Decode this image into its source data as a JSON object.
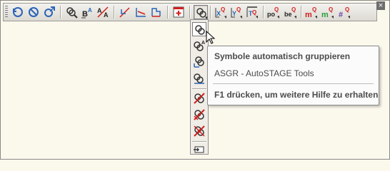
{
  "toolbar": {
    "close_glyph": "×",
    "buttons": [
      {
        "name": "rotate-icon",
        "label": ""
      },
      {
        "name": "rotate-cancel-icon",
        "label": ""
      },
      {
        "name": "rotate-arrow-icon",
        "label": ""
      },
      {
        "name": "position-number-search-icon",
        "label": ""
      },
      {
        "name": "text-size-b-a-icon",
        "label": "B A"
      },
      {
        "name": "text-size-a-a-icon",
        "label": "A A"
      },
      {
        "name": "dimension-line-icon",
        "label": ""
      },
      {
        "name": "arc-dimension-icon",
        "label": ""
      },
      {
        "name": "angle-dimension-icon",
        "label": ""
      },
      {
        "name": "insert-table-icon",
        "label": ""
      },
      {
        "name": "group-symbols-icon",
        "label": ""
      },
      {
        "name": "label-x-q-icon",
        "label": "X Q"
      },
      {
        "name": "label-y-q-icon",
        "label": "Y Q"
      },
      {
        "name": "label-overline-q-icon",
        "label": "Q"
      },
      {
        "name": "label-po-q-icon",
        "label": "po Q"
      },
      {
        "name": "label-be-q-icon",
        "label": "be Q"
      },
      {
        "name": "label-m-q-red-icon",
        "label": "m Q"
      },
      {
        "name": "label-m-q-green-icon",
        "label": "m Q"
      },
      {
        "name": "label-hash-q-icon",
        "label": "# Q"
      }
    ]
  },
  "palette": {
    "items": [
      {
        "name": "group-auto-icon"
      },
      {
        "name": "group-label-icon"
      },
      {
        "name": "group-arrow-icon"
      },
      {
        "name": "group-select-icon"
      },
      {
        "name": "ungroup-icon"
      },
      {
        "name": "ungroup-all-icon"
      },
      {
        "name": "ungroup-remove-icon"
      },
      {
        "name": "insert-block-icon"
      }
    ]
  },
  "tooltip": {
    "title": "Symbole automatisch gruppieren",
    "subtitle": "ASGR - AutoSTAGE Tools",
    "help": "F1 drücken, um weitere Hilfe zu erhalten"
  },
  "colors": {
    "accent_blue": "#2a64b8",
    "accent_red": "#d21e1e",
    "accent_green": "#2a9d3a",
    "accent_purple": "#6b3fb0"
  }
}
